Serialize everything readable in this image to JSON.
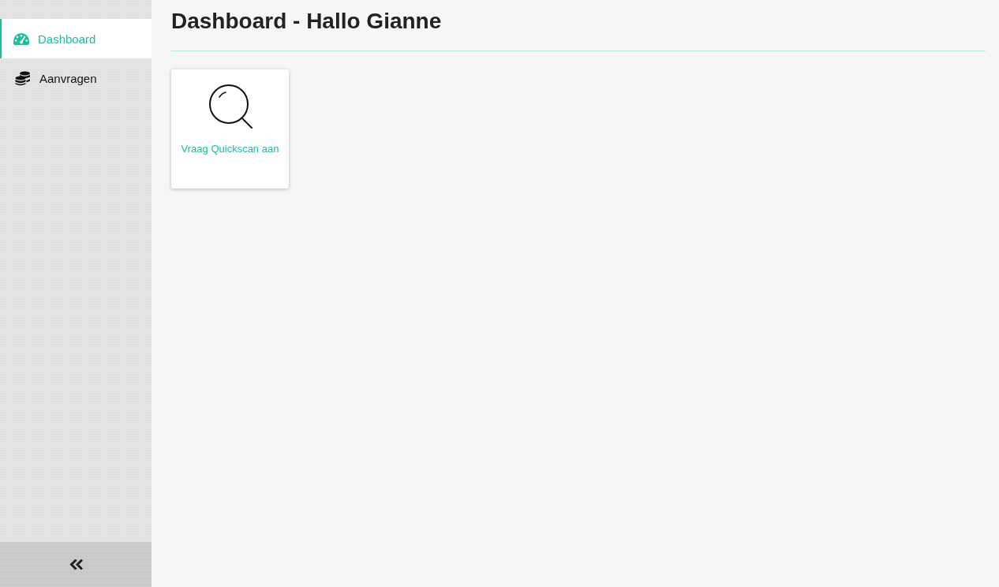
{
  "sidebar": {
    "items": [
      {
        "label": "Dashboard",
        "selected": true
      },
      {
        "label": "Aanvragen",
        "selected": false
      }
    ]
  },
  "main": {
    "title": "Dashboard - Hallo Gianne",
    "cards": [
      {
        "label": "Vraag Quickscan aan"
      }
    ]
  }
}
